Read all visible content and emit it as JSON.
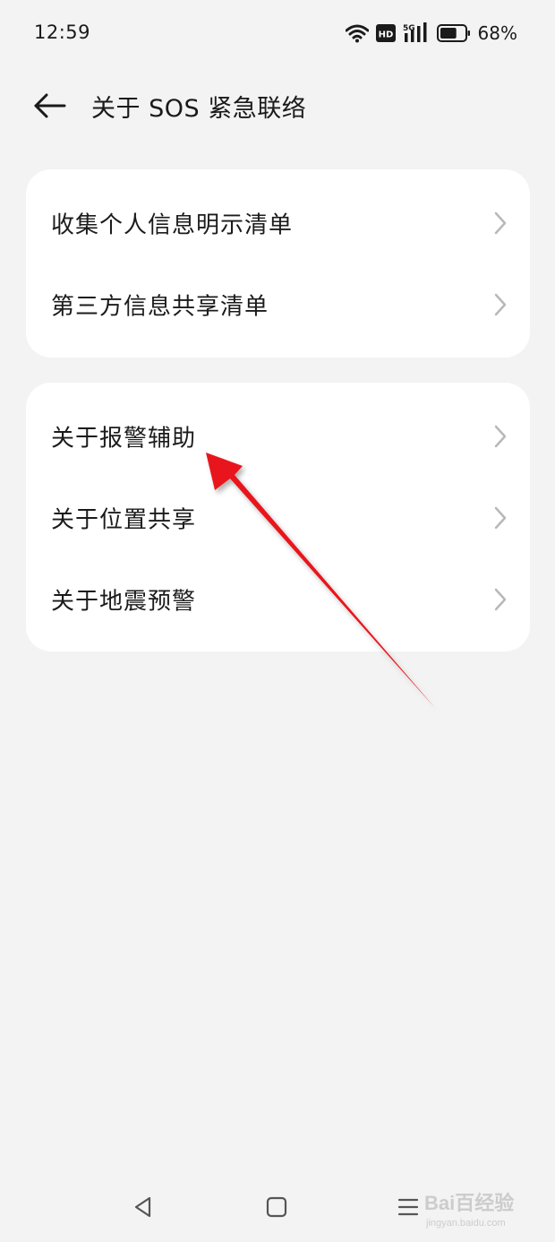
{
  "status_bar": {
    "time": "12:59",
    "hd_label": "HD",
    "network_label": "5G",
    "battery_percent": "68%",
    "battery_level": 0.68
  },
  "header": {
    "back_icon": "arrow-left-icon",
    "title": "关于 SOS 紧急联络"
  },
  "cards": [
    {
      "items": [
        {
          "label": "收集个人信息明示清单",
          "icon": "chevron-right-icon"
        },
        {
          "label": "第三方信息共享清单",
          "icon": "chevron-right-icon"
        }
      ]
    },
    {
      "items": [
        {
          "label": "关于报警辅助",
          "icon": "chevron-right-icon"
        },
        {
          "label": "关于位置共享",
          "icon": "chevron-right-icon"
        },
        {
          "label": "关于地震预警",
          "icon": "chevron-right-icon"
        }
      ]
    }
  ],
  "navigation_bar": {
    "buttons": [
      "back-triangle-icon",
      "home-square-icon",
      "recents-menu-icon"
    ]
  },
  "annotation": {
    "arrow_color": "#e8161b"
  },
  "watermark": {
    "brand": "Bai百经验",
    "url": "jingyan.baidu.com"
  },
  "colors": {
    "background": "#f3f3f3",
    "card": "#ffffff",
    "text": "#1b1b1b",
    "chevron": "#b8b8b8"
  }
}
